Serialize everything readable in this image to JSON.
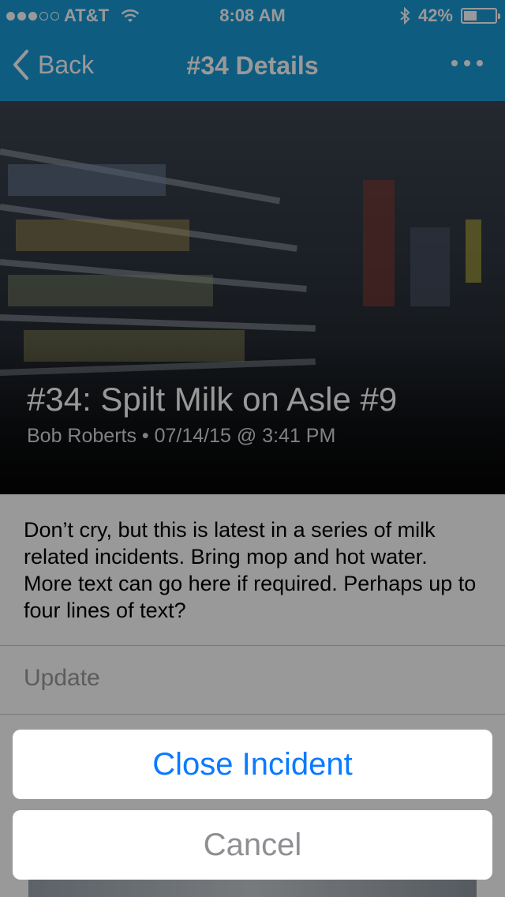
{
  "status_bar": {
    "carrier": "AT&T",
    "time": "8:08 AM",
    "battery_percent": "42%",
    "battery_level": 0.42,
    "signal_bars_filled": 3,
    "signal_bars_total": 5
  },
  "nav": {
    "back_label": "Back",
    "title": "#34 Details"
  },
  "incident": {
    "title": "#34: Spilt Milk on Asle #9",
    "meta": "Bob Roberts • 07/14/15 @ 3:41 PM",
    "description": "Don’t cry, but this is latest in a series of milk related incidents. Bring mop and hot water. More text can go here if required. Perhaps up to four lines of text?",
    "update_label": "Update"
  },
  "action_sheet": {
    "close_label": "Close Incident",
    "cancel_label": "Cancel"
  },
  "colors": {
    "accent": "#1a9ad8",
    "action_blue": "#0a7aff",
    "cancel_gray": "#8e8e93"
  },
  "icons": [
    "wifi-icon",
    "bluetooth-icon",
    "battery-icon",
    "chevron-left-icon",
    "more-icon"
  ]
}
